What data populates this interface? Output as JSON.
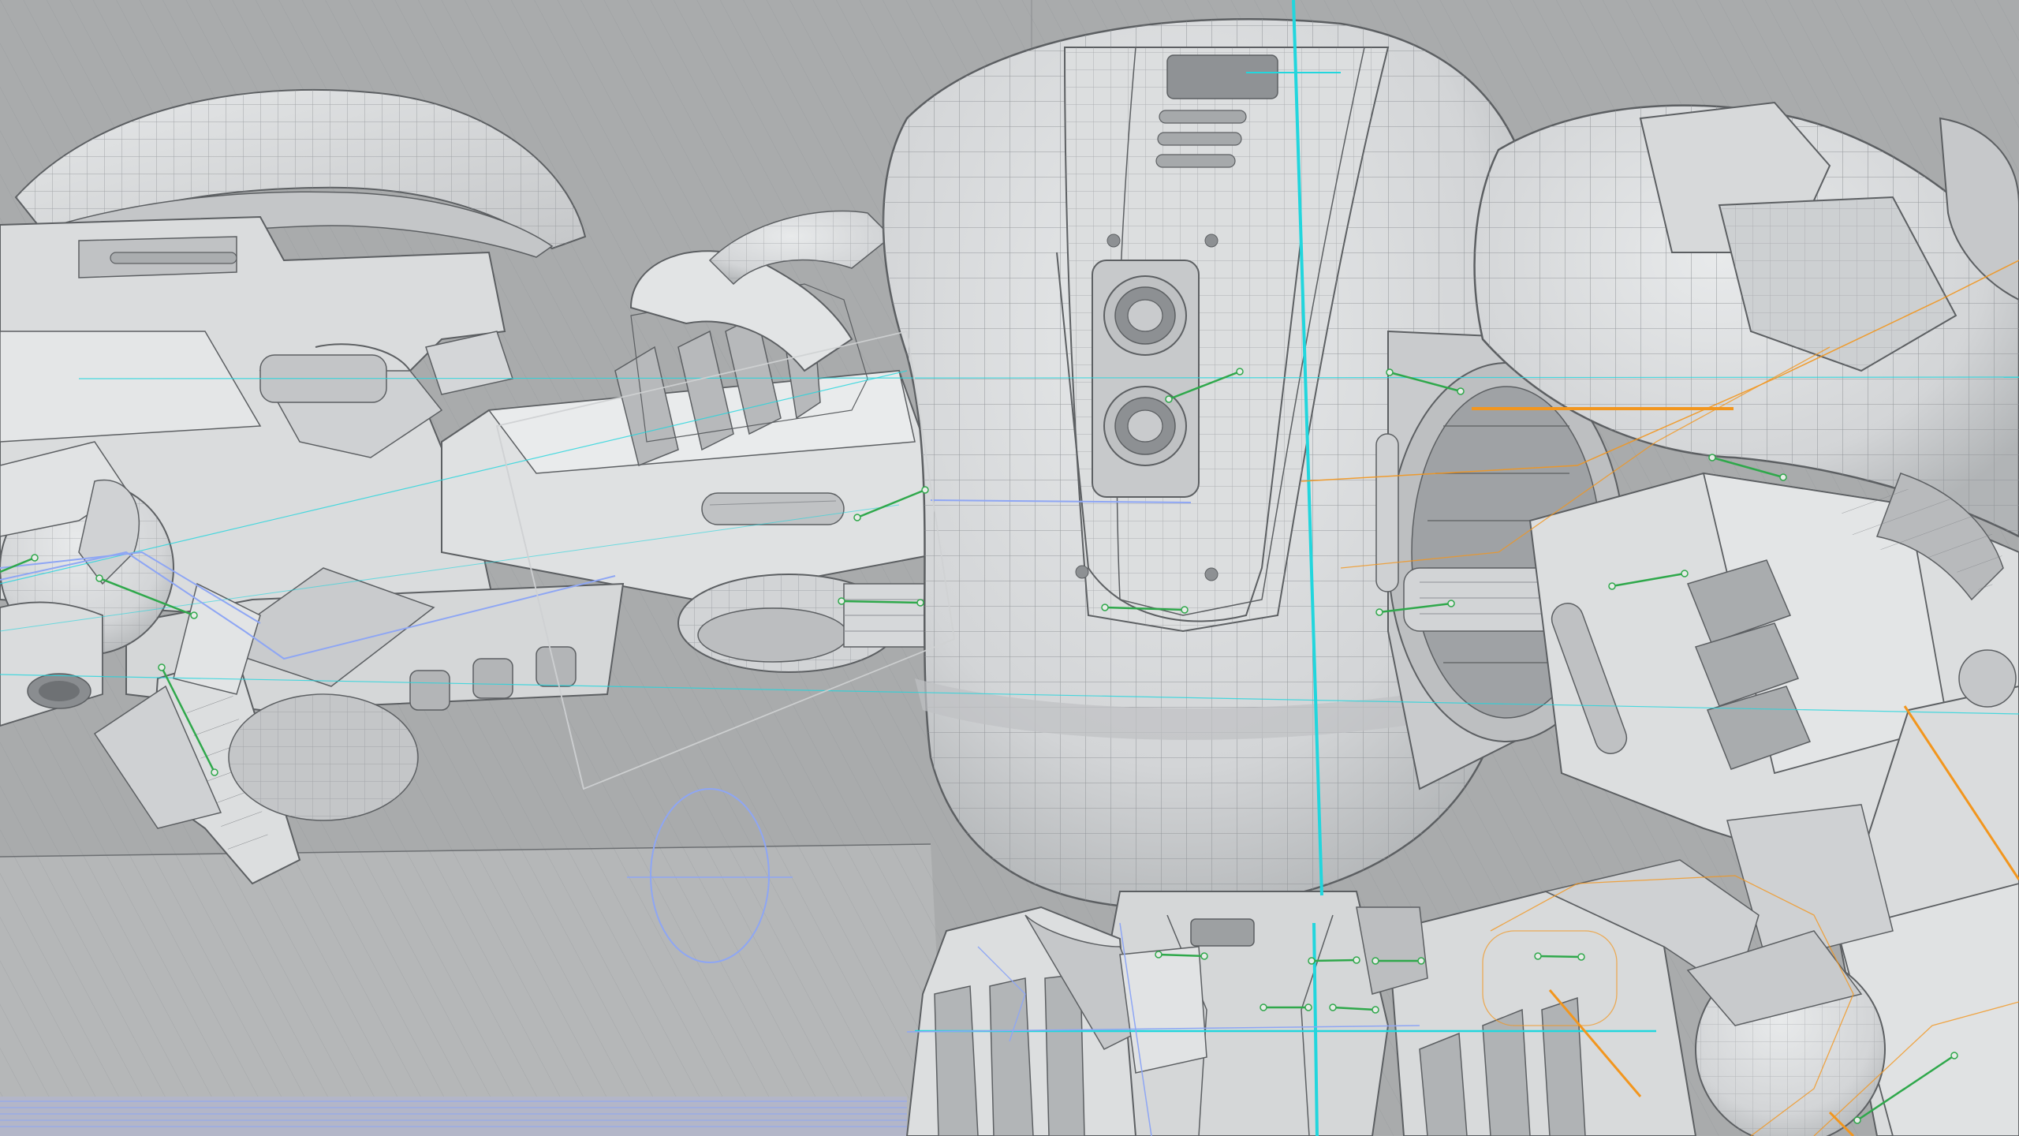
{
  "viewport": {
    "background_color": "#a9abac",
    "floor_color": "#b6b8b9",
    "shell_color": "#dcdedf",
    "shell_shade_color": "#b9bbbd",
    "edge_color": "#5c5f62",
    "mesh_color": "#8e9195"
  },
  "axis_guides": {
    "cyan_color": "#22d6dd",
    "blue_color": "#8ea6f4",
    "orange_color": "#f2961e",
    "green_color": "#2fa84b"
  },
  "rig_markers": {
    "count": 18,
    "icon": "rig-handle-icon"
  }
}
